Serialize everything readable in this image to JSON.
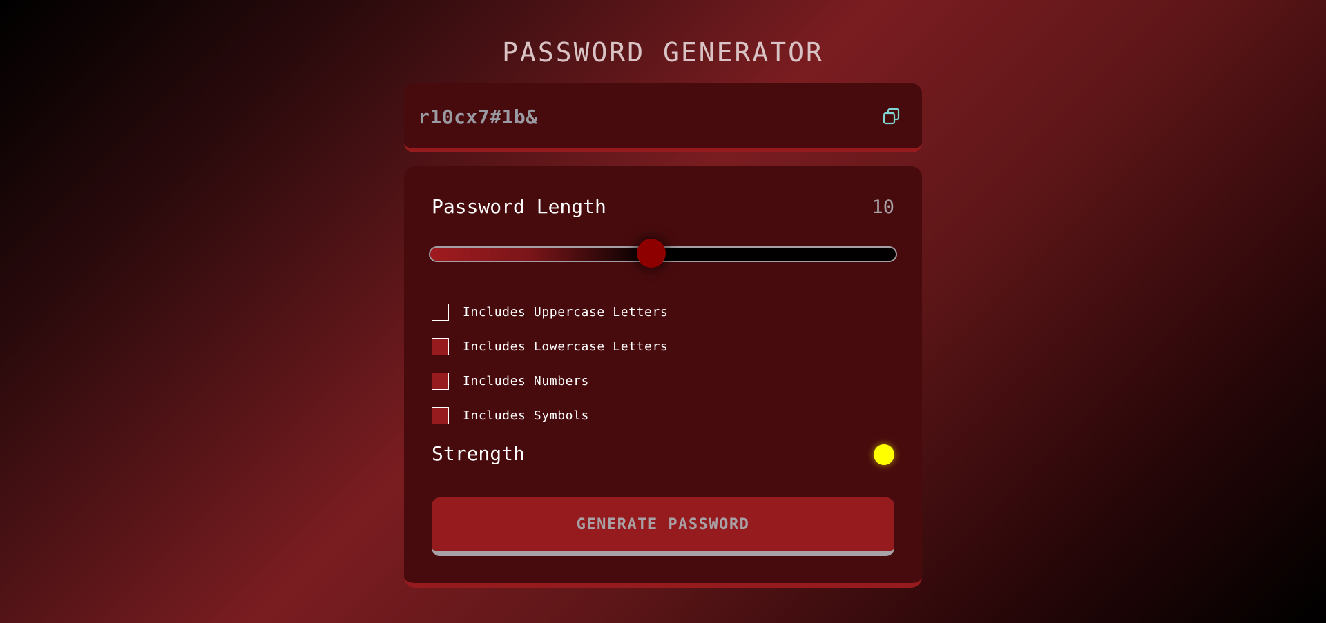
{
  "title": "PASSWORD GENERATOR",
  "password": {
    "value": "r10cx7#1b&",
    "copy_icon": "copy-icon"
  },
  "length": {
    "label": "Password Length",
    "value": "10",
    "slider_fraction": 0.475
  },
  "options": [
    {
      "label": "Includes Uppercase Letters",
      "checked": false
    },
    {
      "label": "Includes Lowercase Letters",
      "checked": true
    },
    {
      "label": "Includes Numbers",
      "checked": true
    },
    {
      "label": "Includes Symbols",
      "checked": true
    }
  ],
  "strength": {
    "label": "Strength",
    "color": "#ffff00"
  },
  "generate_button": "GENERATE PASSWORD",
  "colors": {
    "accent": "#961b1e",
    "panel": "#480b0d",
    "thumb": "#8e0000",
    "copy_icon": "#7fd6d3"
  }
}
